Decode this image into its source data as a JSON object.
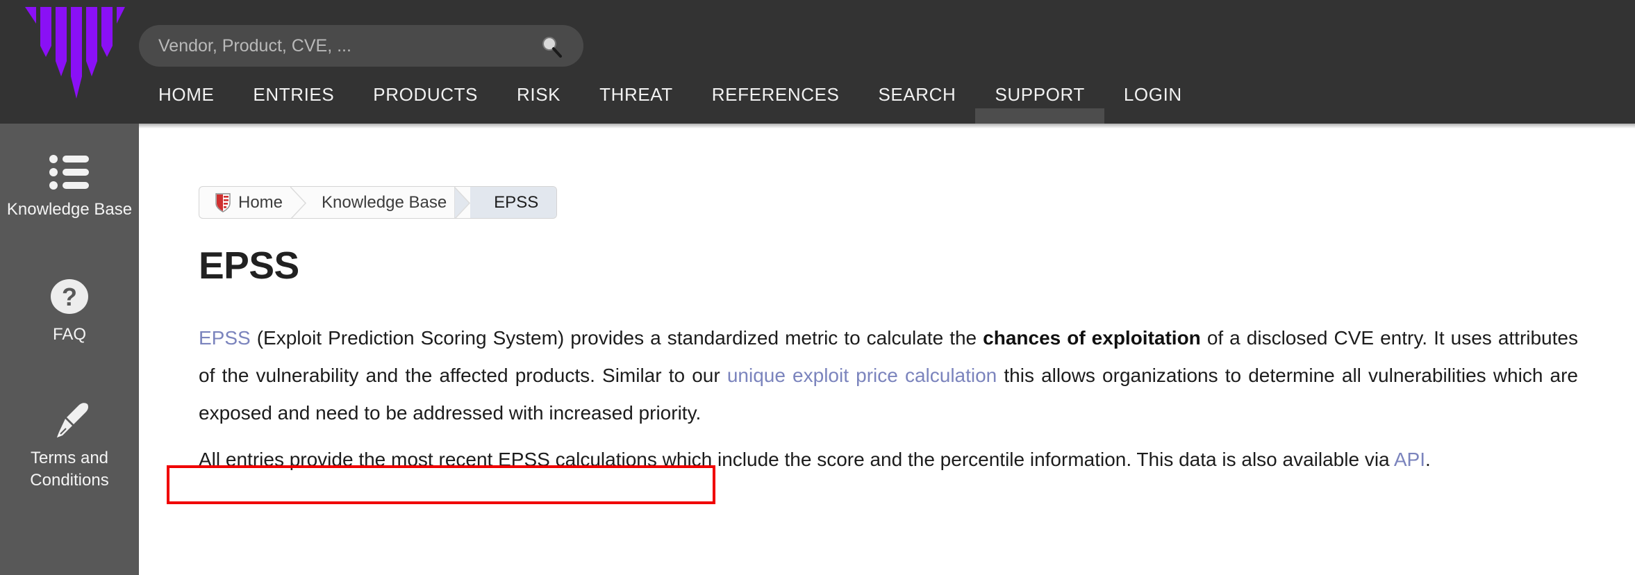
{
  "header": {
    "logo_name": "vuldb-logo",
    "logo_color": "#8a10f5",
    "background": "#333333",
    "search": {
      "placeholder": "Vendor, Product, CVE, ...",
      "value": "",
      "icon": "search-icon"
    },
    "nav": [
      {
        "label": "HOME",
        "active": false
      },
      {
        "label": "ENTRIES",
        "active": false
      },
      {
        "label": "PRODUCTS",
        "active": false
      },
      {
        "label": "RISK",
        "active": false
      },
      {
        "label": "THREAT",
        "active": false
      },
      {
        "label": "REFERENCES",
        "active": false
      },
      {
        "label": "SEARCH",
        "active": false
      },
      {
        "label": "SUPPORT",
        "active": true
      },
      {
        "label": "LOGIN",
        "active": false
      }
    ]
  },
  "sidebar": {
    "background": "#585858",
    "items": [
      {
        "label": "Knowledge Base",
        "icon": "list-icon"
      },
      {
        "label": "FAQ",
        "icon": "question-circle-icon"
      },
      {
        "label": "Terms and Conditions",
        "icon": "pen-nib-icon"
      }
    ]
  },
  "breadcrumb": {
    "items": [
      {
        "label": "Home",
        "icon": "shield-icon",
        "current": false
      },
      {
        "label": "Knowledge Base",
        "icon": "",
        "current": false
      },
      {
        "label": "EPSS",
        "icon": "",
        "current": true
      }
    ]
  },
  "main": {
    "title": "EPSS",
    "paragraph_1": {
      "link_1": "EPSS",
      "text_1": " (Exploit Prediction Scoring System) provides a standardized metric to calculate the ",
      "bold_1": "chances of exploitation",
      "text_2": " of a disclosed CVE entry. It uses attributes of the vulnerability and the affected products. Similar to our ",
      "link_2": "unique exploit price calculation",
      "text_3": " this allows organizations to determine all vulnerabilities which are exposed and need to be addressed with increased priority."
    },
    "paragraph_2": {
      "text_1": "All entries provide the most recent EPSS calculations which include the score and the percentile information. This data is also available via ",
      "link_1": "API",
      "text_2": "."
    },
    "link_color": "#7b84bd"
  },
  "annotation": {
    "name": "highlight-box",
    "color": "#f00000",
    "highlighted_text": "All entries provide the most recent EPSS calculations"
  }
}
